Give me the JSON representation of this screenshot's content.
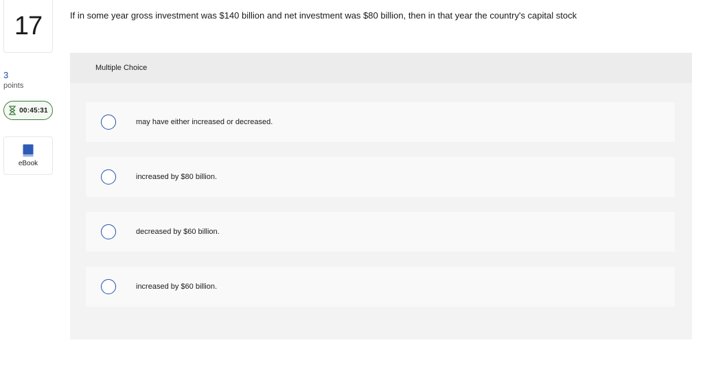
{
  "question_number": "17",
  "points": {
    "value": "3",
    "label": "points"
  },
  "timer": {
    "time": "00:45:31",
    "icon": "hourglass-icon",
    "color": "#3b7a3b"
  },
  "ebook": {
    "label": "eBook",
    "icon": "book-icon",
    "color": "#2d5bb5"
  },
  "question_text": "If in some year gross investment was $140 billion and net investment was $80 billion, then in that year the country's capital stock",
  "answer_panel": {
    "header": "Multiple Choice",
    "choices": [
      {
        "label": "may have either increased or decreased."
      },
      {
        "label": "increased by $80 billion."
      },
      {
        "label": "decreased by $60 billion."
      },
      {
        "label": "increased by $60 billion."
      }
    ]
  },
  "colors": {
    "accent": "#1f4fa8",
    "panel_bg": "#f3f3f3",
    "choice_bg": "#f9f9f9"
  }
}
